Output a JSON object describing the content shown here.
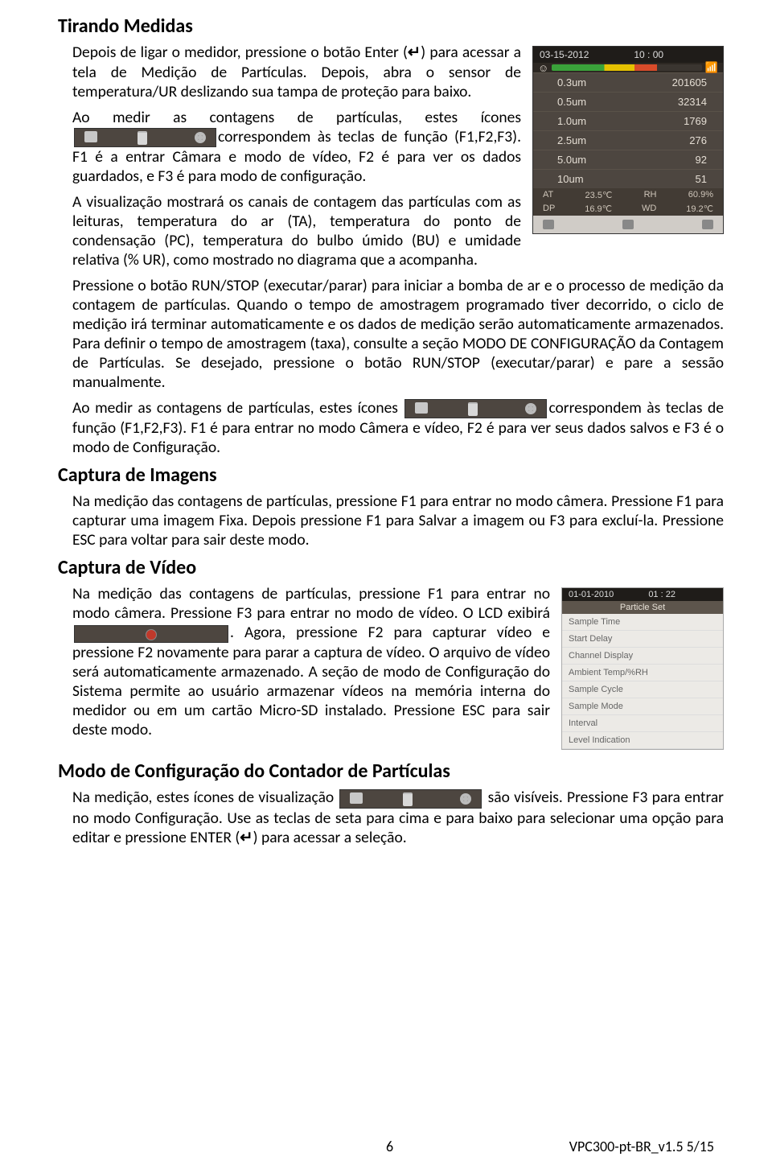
{
  "sections": {
    "tirando": {
      "title": "Tirando Medidas",
      "p1a": "Depois de ligar o medidor, pressione o botão Enter (",
      "p1b": ") para acessar a tela de Medição de Partículas. Depois, abra o sensor de temperatura/UR deslizando sua tampa de proteção para baixo.",
      "p2a": "Ao medir as contagens de partículas, estes ícones ",
      "p2b": "correspondem às teclas de função (F1,F2,F3). F1 é a entrar Câmara e modo de vídeo, F2 é para ver os dados guardados, e F3 é para modo de configuração.",
      "p3": "A visualização mostrará os canais de contagem das partículas com as leituras, temperatura do ar (TA), temperatura do ponto de condensação (PC), temperatura do bulbo úmido (BU) e umidade relativa (% UR), como mostrado no diagrama que a acompanha.",
      "p4": "Pressione o botão RUN/STOP (executar/parar) para iniciar a bomba de ar e o processo de medição da contagem de partículas. Quando o tempo de amostragem programado tiver decorrido, o ciclo de medição irá terminar automaticamente e os dados de medição serão automaticamente armazenados. Para definir o tempo de amostragem (taxa), consulte a seção MODO DE CONFIGURAÇÃO da Contagem de Partículas. Se desejado, pressione o botão RUN/STOP (executar/parar) e pare a sessão manualmente.",
      "p5a": "Ao medir as contagens de partículas, estes ícones ",
      "p5b": "correspondem às teclas de função (F1,F2,F3).  F1 é para entrar no modo Câmera e vídeo, F2 é para ver seus dados salvos e F3 é o modo de Configuração."
    },
    "imagens": {
      "title": "Captura de Imagens",
      "p1": "Na medição das contagens de partículas, pressione F1 para entrar no modo câmera. Pressione F1 para capturar uma imagem Fixa.  Depois pressione F1 para Salvar a imagem ou F3 para excluí-la.  Pressione ESC para voltar para sair deste modo."
    },
    "video": {
      "title": "Captura de Vídeo",
      "p1a": "Na medição das contagens de partículas, pressione F1 para entrar no modo câmera. Pressione F3 para entrar no modo de vídeo. O LCD exibirá ",
      "p1b": ". Agora, pressione F2 para capturar vídeo e pressione F2 novamente para parar a captura de vídeo. O arquivo de vídeo será automaticamente armazenado. A seção de modo de Configuração do Sistema permite ao usuário armazenar vídeos na memória interna do medidor ou em um cartão Micro-SD instalado. Pressione ESC para sair deste modo."
    },
    "config": {
      "title": "Modo de Configuração do Contador de Partículas",
      "p1a": "Na medição, estes ícones de visualização ",
      "p1b": " são visíveis. Pressione F3 para entrar no modo Configuração. Use as teclas de seta para cima e para baixo para selecionar uma opção para editar e pressione ENTER (",
      "p1c": ")  para acessar a seleção."
    }
  },
  "glyphs": {
    "enter": "↵"
  },
  "shot1": {
    "date": "03-15-2012",
    "time": "10 : 00",
    "rows": [
      {
        "size": "0.3um",
        "count": "201605"
      },
      {
        "size": "0.5um",
        "count": "32314"
      },
      {
        "size": "1.0um",
        "count": "1769"
      },
      {
        "size": "2.5um",
        "count": "276"
      },
      {
        "size": "5.0um",
        "count": "92"
      },
      {
        "size": "10um",
        "count": "51"
      }
    ],
    "env1a": "AT",
    "env1b": "23.5℃",
    "env1c": "RH",
    "env1d": "60.9%",
    "env2a": "DP",
    "env2b": "16.9℃",
    "env2c": "WD",
    "env2d": "19.2℃"
  },
  "shot2": {
    "date": "01-01-2010",
    "time": "01 : 22",
    "header": "Particle   Set",
    "items": [
      "Sample Time",
      "Start Delay",
      "Channel Display",
      "Ambient Temp/%RH",
      "Sample   Cycle",
      "Sample   Mode",
      "Interval",
      "Level   Indication"
    ]
  },
  "footer": {
    "page": "6",
    "rev": "VPC300-pt-BR_v1.5   5/15"
  }
}
